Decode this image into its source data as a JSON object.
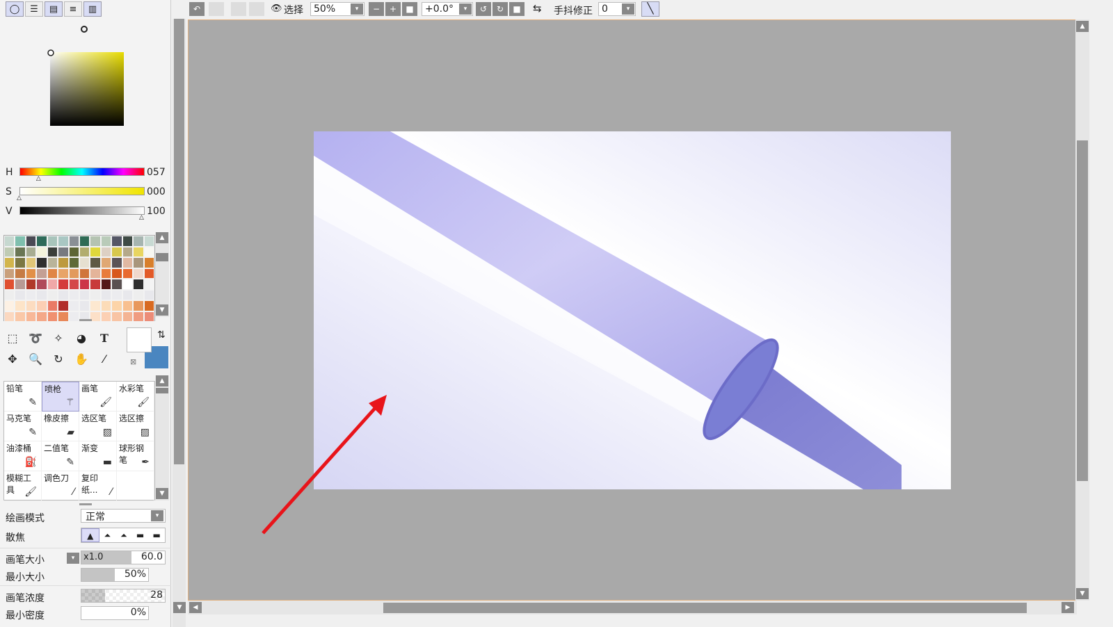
{
  "color_panel": {
    "mode_tabs": [
      {
        "name": "color-wheel"
      },
      {
        "name": "rgb-sliders"
      },
      {
        "name": "hsv-sliders"
      },
      {
        "name": "swatch-list"
      },
      {
        "name": "palette-grid"
      }
    ],
    "sliders": [
      {
        "label": "H",
        "value": "057"
      },
      {
        "label": "S",
        "value": "000"
      },
      {
        "label": "V",
        "value": "100"
      }
    ],
    "hue": 57,
    "saturation": 0,
    "brightness": 100
  },
  "palette": {
    "colors": [
      "#c6d8d0",
      "#7fbfae",
      "#4a4a54",
      "#2f6b5a",
      "#a8c4bb",
      "#a9c7c3",
      "#8a8f95",
      "#2f6b55",
      "#b4c3b1",
      "#b9cbb9",
      "#555766",
      "#3f4b45",
      "#a6b5b0",
      "#c8dad3",
      "#bfcbb4",
      "#6a7654",
      "#a8ad92",
      "#f3f3dc",
      "#3b3e3a",
      "#787a80",
      "#5d6535",
      "#b2ad6e",
      "#e0d83b",
      "#ddd0c4",
      "#d8c84d",
      "#b5a98a",
      "#e8d560",
      "#f7f7f1",
      "#d2b54c",
      "#7c7843",
      "#e0c678",
      "#2f2f2f",
      "#b9b49a",
      "#bd9a3e",
      "#5f6a38",
      "#e6e0d0",
      "#5e5a45",
      "#e0a874",
      "#5b5357",
      "#e0b8a2",
      "#a9967c",
      "#d87f2c",
      "#c9a07c",
      "#c67c44",
      "#e29048",
      "#c4a094",
      "#e08646",
      "#e8a468",
      "#e29a5e",
      "#d0763c",
      "#e4b49a",
      "#e87c3c",
      "#d8581c",
      "#e86a30",
      "#f0d8cc",
      "#e25a28",
      "#e05030",
      "#b89a94",
      "#b03a2a",
      "#b04a5a",
      "#f0a8a8",
      "#d43c3c",
      "#d44848",
      "#cc3448",
      "#c83a3a",
      "#541818",
      "#5a5050",
      "#ffffff",
      "#303030",
      "#f4f4f4",
      "#eeeeee",
      "#e8e8ec",
      "#ececef",
      "#e8e8ec",
      "#eeeeee",
      "#e8e8ec",
      "#ececef",
      "#e8e8ec",
      "#eeeeee",
      "#e8e8ec",
      "#ececef",
      "#e8e8ec",
      "#eeeeee",
      "#e8e8ec",
      "#fdf1e4",
      "#fde4c8",
      "#fcdcc0",
      "#fccfb4",
      "#ea7a66",
      "#b22e2a",
      "#ececef",
      "#e8e8ec",
      "#fde8d0",
      "#fcdcb8",
      "#fcd4a8",
      "#f8c090",
      "#e8985c",
      "#d86a20",
      "#fbd8c0",
      "#fac8a8",
      "#f8b898",
      "#f4a888",
      "#f09070",
      "#e88858",
      "#ececef",
      "#e8e8ec",
      "#fce0c8",
      "#fcd0b4",
      "#f8c4a4",
      "#f4b494",
      "#f09c80",
      "#ec8c78"
    ]
  },
  "tools": {
    "items": [
      {
        "name": "rect-select",
        "glyph": "⬚"
      },
      {
        "name": "lasso",
        "glyph": "➰"
      },
      {
        "name": "magic-wand",
        "glyph": "✧"
      },
      {
        "name": "shape",
        "glyph": "◕"
      },
      {
        "name": "text",
        "glyph": "T"
      },
      {
        "name": "move",
        "glyph": "✥"
      },
      {
        "name": "zoom",
        "glyph": "🔍"
      },
      {
        "name": "rotate",
        "glyph": "↻"
      },
      {
        "name": "hand",
        "glyph": "✋"
      },
      {
        "name": "eyedropper",
        "glyph": "⁄"
      }
    ],
    "primary_color": "#ffffff",
    "secondary_color": "#4a86c0"
  },
  "brushes": [
    {
      "label": "铅笔",
      "glyph": "✎"
    },
    {
      "label": "喷枪",
      "glyph": "⚚",
      "selected": true
    },
    {
      "label": "画笔",
      "glyph": "🖌"
    },
    {
      "label": "水彩笔",
      "glyph": "🖌"
    },
    {
      "label": "马克笔",
      "glyph": "✎"
    },
    {
      "label": "橡皮擦",
      "glyph": "▰"
    },
    {
      "label": "选区笔",
      "glyph": "▨"
    },
    {
      "label": "选区擦",
      "glyph": "▨"
    },
    {
      "label": "油漆桶",
      "glyph": "⛽"
    },
    {
      "label": "二值笔",
      "glyph": "✎"
    },
    {
      "label": "渐变",
      "glyph": "▬"
    },
    {
      "label": "球形钢笔",
      "glyph": "✒"
    },
    {
      "label": "模糊工具",
      "glyph": "🖌"
    },
    {
      "label": "调色刀",
      "glyph": "⁄"
    },
    {
      "label": "复印纸...",
      "glyph": "⁄"
    },
    {
      "label": "",
      "glyph": ""
    }
  ],
  "brush_settings": {
    "mode_label": "绘画模式",
    "mode_value": "正常",
    "blur_label": "散焦",
    "blur_shapes": [
      "▲",
      "⏶",
      "⏶",
      "▬",
      "▬"
    ],
    "size_label": "画笔大小",
    "size_multiplier": "x1.0",
    "size_value": "60.0",
    "size_fraction": 0.6,
    "min_size_label": "最小大小",
    "min_size_value": "50%",
    "min_size_fraction": 0.5,
    "density_label": "画笔浓度",
    "density_value": "28",
    "density_fraction": 0.28,
    "min_density_label": "最小密度",
    "min_density_value": "0%"
  },
  "toolbar": {
    "select_label": "选择",
    "zoom_value": "50%",
    "rotation_value": "+0.0°",
    "stabilizer_label": "手抖修正",
    "stabilizer_value": "0"
  },
  "canvas": {
    "arrow_color": "#e8141a"
  }
}
